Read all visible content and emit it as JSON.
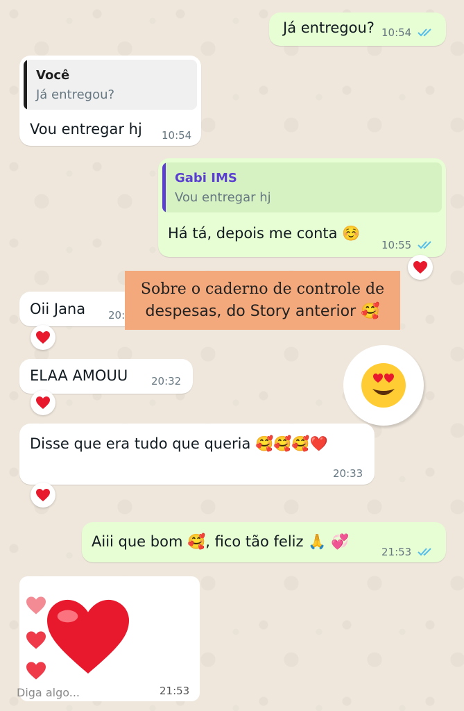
{
  "messages": [
    {
      "id": "m1",
      "direction": "out",
      "text": "Já entregou?",
      "time": "10:54",
      "read": true
    },
    {
      "id": "m2",
      "direction": "in",
      "quote": {
        "author": "Você",
        "text": "Já entregou?"
      },
      "text": "Vou entregar hj",
      "time": "10:54"
    },
    {
      "id": "m3",
      "direction": "out",
      "quote": {
        "author": "Gabi IMS",
        "text": "Vou entregar hj"
      },
      "text": "Há tá, depois me conta ☺️",
      "time": "10:55",
      "read": true,
      "reaction": "red-heart"
    },
    {
      "id": "m4",
      "direction": "in",
      "text": "Oii Jana",
      "time": "20:3",
      "reaction": "red-heart"
    },
    {
      "id": "m5",
      "direction": "in",
      "text": "ELAA AMOUU",
      "time": "20:32",
      "reaction": "red-heart"
    },
    {
      "id": "m6",
      "direction": "in",
      "text": "Disse que era tudo que queria 🥰🥰🥰❤️",
      "time": "20:33",
      "reaction": "red-heart"
    },
    {
      "id": "m7",
      "direction": "out",
      "text": "Aiii que bom 🥰, fico tão feliz 🙏 💞",
      "time": "21:53",
      "read": true
    },
    {
      "id": "m8",
      "direction": "in",
      "type": "heart-sticker",
      "time": "21:53"
    }
  ],
  "story_overlay": {
    "line1": "Sobre o caderno de controle de",
    "line2": "despesas, do Story anterior 🥰"
  },
  "sticker": {
    "emoji": "😍"
  },
  "composer": {
    "placeholder": "Diga algo..."
  },
  "colors": {
    "outgoing_bubble": "#e7fdd3",
    "incoming_bubble": "#ffffff",
    "read_ticks": "#53bdeb",
    "quote_self_bar": "#1f1f1f",
    "quote_contact_bar": "#5b3fd0",
    "quote_contact_name": "#5b3fd0",
    "overlay_bg": "#f4a97c",
    "heart": "#e8192c"
  }
}
